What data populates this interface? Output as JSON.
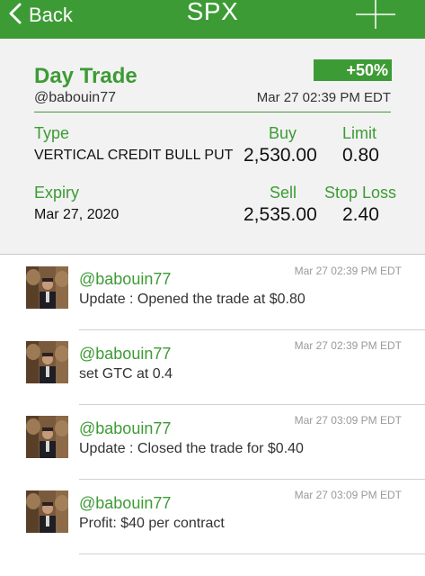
{
  "nav": {
    "back_label": "Back",
    "title": "SPX",
    "back_icon": "chevron-left-icon",
    "add_icon": "plus-icon",
    "bar_color": "#3d9b35"
  },
  "trade": {
    "title": "Day Trade",
    "change_badge": "+50%",
    "user": "@babouin77",
    "timestamp": "Mar 27 02:39 PM EDT",
    "type_label": "Type",
    "type_value": "VERTICAL CREDIT BULL PUT",
    "buy_label": "Buy",
    "buy_value": "2,530.00",
    "limit_label": "Limit",
    "limit_value": "0.80",
    "expiry_label": "Expiry",
    "expiry_value": "Mar 27, 2020",
    "sell_label": "Sell",
    "sell_value": "2,535.00",
    "stop_loss_label": "Stop Loss",
    "stop_loss_value": "2.40"
  },
  "posts": [
    {
      "user": "@babouin77",
      "time": "Mar 27 02:39 PM EDT",
      "text": "Update : Opened the trade at $0.80"
    },
    {
      "user": "@babouin77",
      "time": "Mar 27 02:39 PM EDT",
      "text": "set GTC at 0.4"
    },
    {
      "user": "@babouin77",
      "time": "Mar 27 03:09 PM EDT",
      "text": "Update : Closed the trade for $0.40"
    },
    {
      "user": "@babouin77",
      "time": "Mar 27 03:09 PM EDT",
      "text": "Profit: $40 per contract"
    }
  ]
}
